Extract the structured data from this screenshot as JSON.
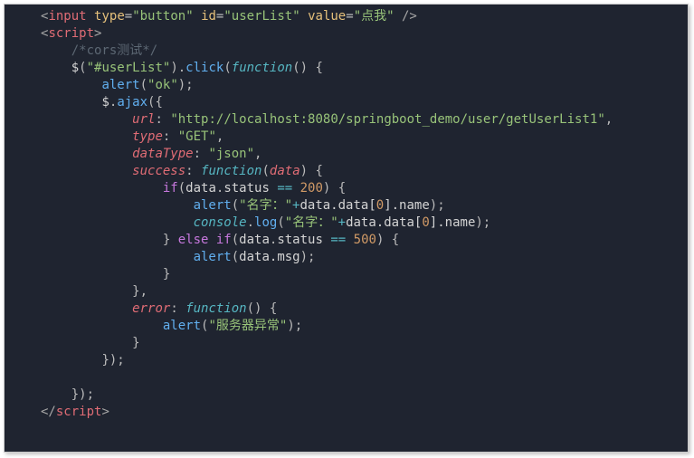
{
  "code": {
    "input_tag_open": "input",
    "input_attr_type": "type",
    "input_val_type": "\"button\"",
    "input_attr_id": "id",
    "input_val_id": "\"userList\"",
    "input_attr_value": "value",
    "input_val_value": "\"点我\"",
    "script_tag": "script",
    "comment_cors": "/*cors测试*/",
    "jq_selector": "\"#userList\"",
    "click_method": "click",
    "fn_keyword": "function",
    "alert_ok": "\"ok\"",
    "ajax_method": "ajax",
    "k_url": "url",
    "v_url": "\"http://localhost:8080/springboot_demo/user/getUserList1\"",
    "k_type": "type",
    "v_type": "\"GET\"",
    "k_dataType": "dataType",
    "v_dataType": "\"json\"",
    "k_success": "success",
    "param_data": "data",
    "if_kw": "if",
    "else_kw": "else",
    "status_prop": "status",
    "eq_200": "200",
    "eq_500": "500",
    "alert_fn": "alert",
    "name_prefix": "\"名字：\"",
    "plus": "+",
    "data_path_open": "data.data[",
    "idx0": "0",
    "data_path_close": "].name",
    "console_var": "console",
    "log_method": "log",
    "msg_prop": "data.msg",
    "k_error": "error",
    "server_err": "\"服务器异常\"",
    "script_close": "script"
  }
}
